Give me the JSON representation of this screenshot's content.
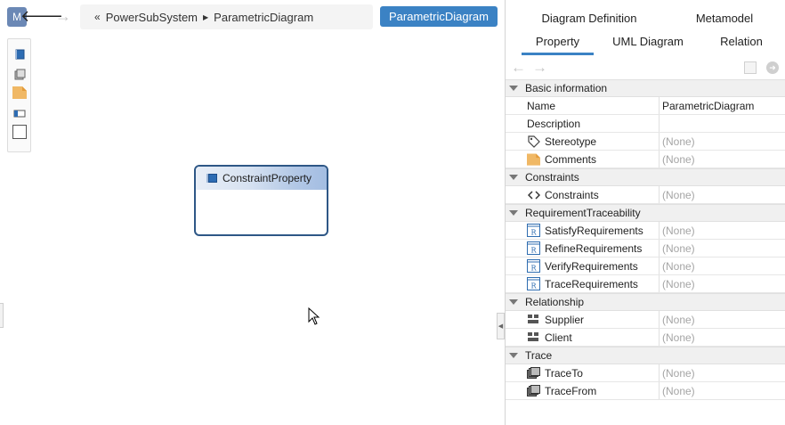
{
  "header": {
    "model_badge": "M",
    "back_glyph": "🡐",
    "forward_glyph": "→",
    "breadcrumb": {
      "root_glyph": "«",
      "parent": "PowerSubSystem",
      "separator_glyph": "▶",
      "current": "ParametricDiagram"
    },
    "diagram_button_label": "ParametricDiagram"
  },
  "palette": {
    "items": [
      "block-icon",
      "part-icon",
      "comment-icon",
      "port-icon",
      "frame-icon"
    ]
  },
  "canvas": {
    "constraint_property": {
      "label": "ConstraintProperty"
    }
  },
  "panel": {
    "tabs_top": [
      {
        "label": "Diagram Definition"
      },
      {
        "label": "Metamodel"
      }
    ],
    "tabs_bottom": [
      {
        "label": "Property",
        "active": true
      },
      {
        "label": "UML Diagram"
      },
      {
        "label": "Relation"
      }
    ],
    "toolbar": {
      "back_glyph": "←",
      "forward_glyph": "→"
    },
    "sections": [
      {
        "title": "Basic information",
        "rows": [
          {
            "name": "Name",
            "value": "ParametricDiagram",
            "icon": ""
          },
          {
            "name": "Description",
            "value": "",
            "icon": ""
          },
          {
            "name": "Stereotype",
            "value": "(None)",
            "icon": "tag-icon"
          },
          {
            "name": "Comments",
            "value": "(None)",
            "icon": "comment-icon"
          }
        ]
      },
      {
        "title": "Constraints",
        "rows": [
          {
            "name": "Constraints",
            "value": "(None)",
            "icon": "code-icon"
          }
        ]
      },
      {
        "title": "RequirementTraceability",
        "rows": [
          {
            "name": "SatisfyRequirements",
            "value": "(None)",
            "icon": "requirement-icon"
          },
          {
            "name": "RefineRequirements",
            "value": "(None)",
            "icon": "requirement-icon"
          },
          {
            "name": "VerifyRequirements",
            "value": "(None)",
            "icon": "requirement-icon"
          },
          {
            "name": "TraceRequirements",
            "value": "(None)",
            "icon": "requirement-icon"
          }
        ]
      },
      {
        "title": "Relationship",
        "rows": [
          {
            "name": "Supplier",
            "value": "(None)",
            "icon": "grid-icon"
          },
          {
            "name": "Client",
            "value": "(None)",
            "icon": "grid-icon"
          }
        ]
      },
      {
        "title": "Trace",
        "rows": [
          {
            "name": "TraceTo",
            "value": "(None)",
            "icon": "stack-icon"
          },
          {
            "name": "TraceFrom",
            "value": "(None)",
            "icon": "stack-icon"
          }
        ]
      }
    ]
  },
  "colors": {
    "accent": "#3b82c4",
    "box_border": "#2e5786",
    "none_text": "#a5a5a5"
  }
}
